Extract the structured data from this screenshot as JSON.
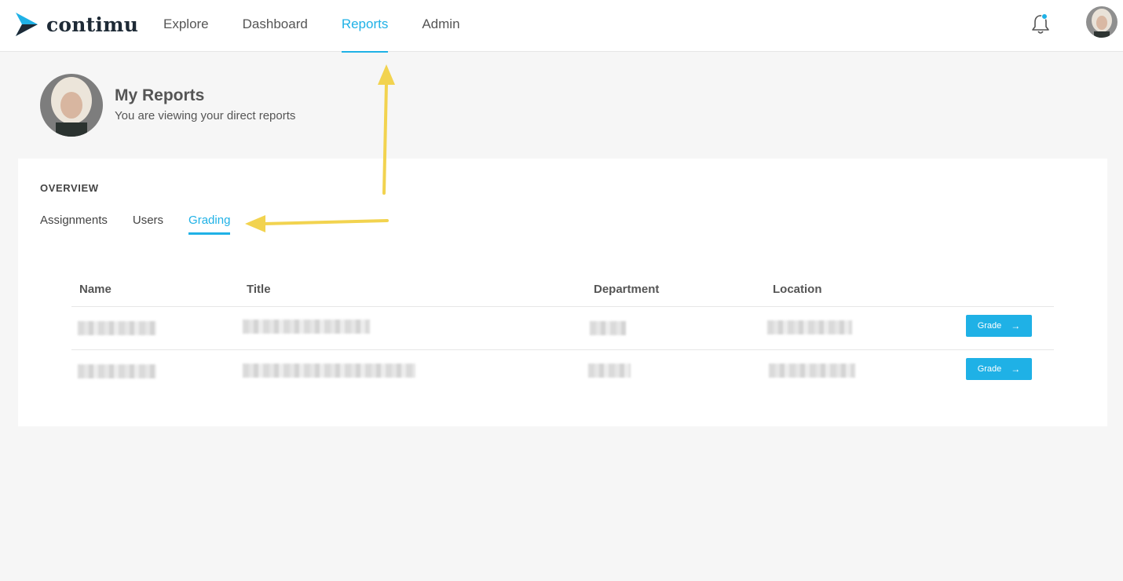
{
  "brand": {
    "name": "contimu"
  },
  "nav": {
    "items": [
      {
        "label": "Explore"
      },
      {
        "label": "Dashboard"
      },
      {
        "label": "Reports"
      },
      {
        "label": "Admin"
      }
    ],
    "active": "Reports"
  },
  "header": {
    "title": "My Reports",
    "subtitle": "You are viewing your direct reports"
  },
  "card": {
    "section_label": "OVERVIEW",
    "tabs": [
      {
        "label": "Assignments"
      },
      {
        "label": "Users"
      },
      {
        "label": "Grading"
      }
    ],
    "active_tab": "Grading"
  },
  "table": {
    "columns": [
      "Name",
      "Title",
      "Department",
      "Location"
    ],
    "rows": [
      {
        "action_label": "Grade"
      },
      {
        "action_label": "Grade"
      }
    ]
  },
  "icons": {
    "logo": "arrow-logo-icon",
    "notifications": "bell-icon",
    "row_action": "arrow-right-icon"
  },
  "colors": {
    "accent": "#1fb1e6",
    "annotation": "#f2d34f",
    "logo_dark": "#1e2a36"
  }
}
